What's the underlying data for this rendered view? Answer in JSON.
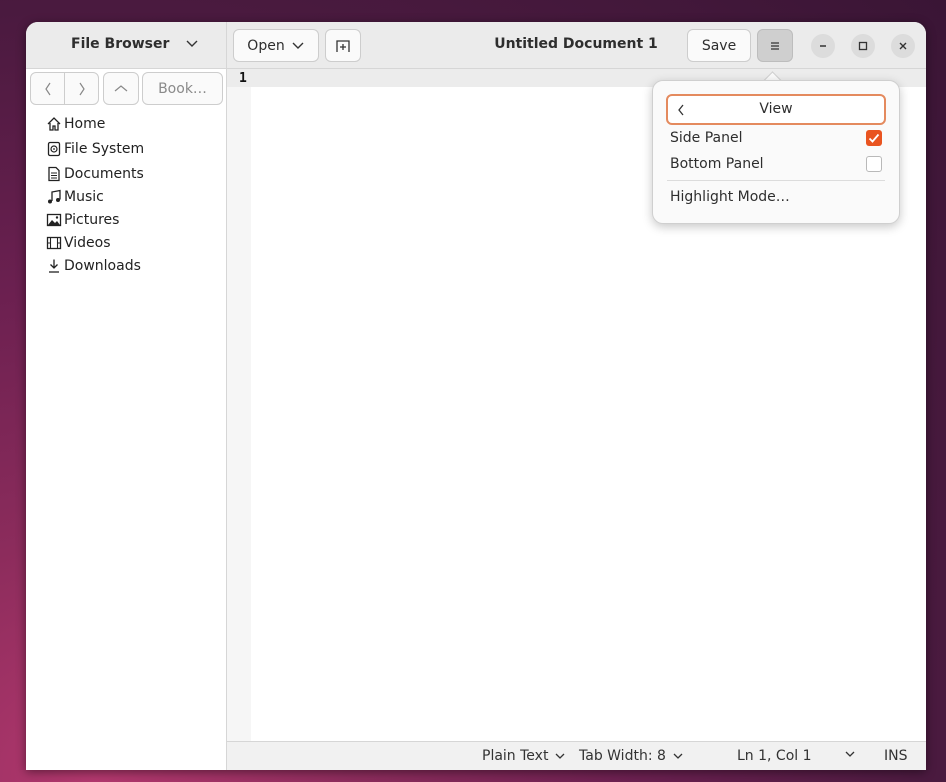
{
  "header": {
    "sidebar_title": "File Browser",
    "open_label": "Open",
    "document_title": "Untitled Document 1",
    "save_label": "Save"
  },
  "sidebar": {
    "bookmarks_label": "Book…",
    "items": [
      {
        "label": "Home",
        "icon": "home-icon"
      },
      {
        "label": "File System",
        "icon": "drive-icon"
      },
      {
        "label": "Documents",
        "icon": "document-icon"
      },
      {
        "label": "Music",
        "icon": "music-icon"
      },
      {
        "label": "Pictures",
        "icon": "picture-icon"
      },
      {
        "label": "Videos",
        "icon": "video-icon"
      },
      {
        "label": "Downloads",
        "icon": "download-icon"
      }
    ]
  },
  "editor": {
    "line_numbers": [
      "1"
    ]
  },
  "popover": {
    "title": "View",
    "items": [
      {
        "label": "Side Panel",
        "checked": true
      },
      {
        "label": "Bottom Panel",
        "checked": false
      },
      {
        "label": "Highlight Mode…"
      }
    ]
  },
  "statusbar": {
    "language": "Plain Text",
    "tab_width": "Tab Width: 8",
    "position": "Ln 1, Col 1",
    "mode": "INS"
  },
  "colors": {
    "accent": "#e95420",
    "focus_ring": "#e48a5e"
  }
}
